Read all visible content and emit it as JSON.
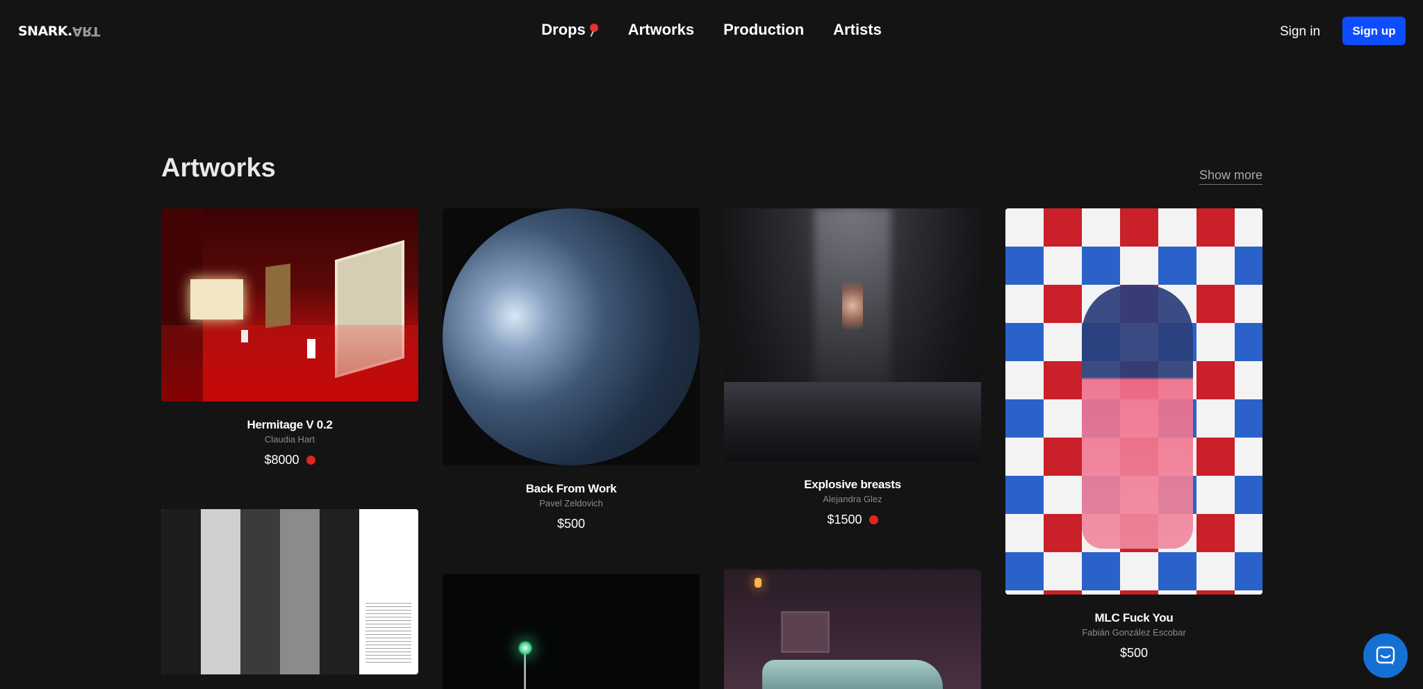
{
  "header": {
    "logo_main": "SNARK.",
    "logo_mirror": "ART",
    "nav": [
      {
        "label": "Drops",
        "icon": "pin-icon"
      },
      {
        "label": "Artworks"
      },
      {
        "label": "Production"
      },
      {
        "label": "Artists"
      }
    ],
    "sign_in": "Sign in",
    "sign_up": "Sign up",
    "accent": "#0d4dff"
  },
  "section": {
    "title": "Artworks",
    "show_more": "Show more"
  },
  "artworks": [
    {
      "title": "Hermitage V 0.2",
      "artist": "Claudia Hart",
      "price": "$8000",
      "status_dot": true
    },
    {
      "title": "Back From Work",
      "artist": "Pavel Zeldovich",
      "price": "$500",
      "status_dot": false
    },
    {
      "title": "Explosive breasts",
      "artist": "Alejandra Glez",
      "price": "$1500",
      "status_dot": true
    },
    {
      "title": "MLC Fuck You",
      "artist": "Fabián González Escobar",
      "price": "$500",
      "status_dot": false
    }
  ],
  "colors": {
    "background": "#141414",
    "status_dot": "#e1261f",
    "chat": "#1570d4"
  },
  "chat_icon": "chat-bubble-icon"
}
